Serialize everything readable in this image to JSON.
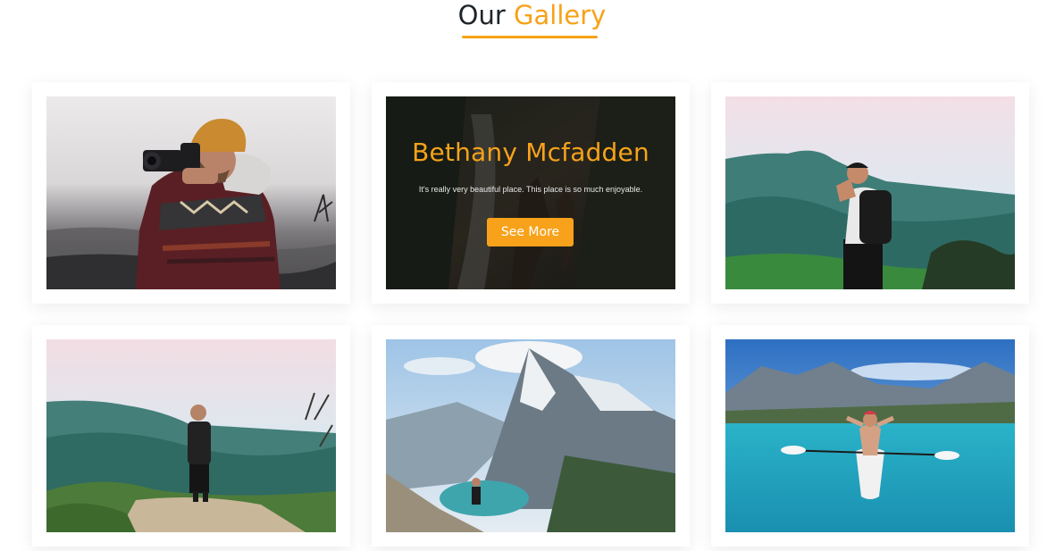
{
  "heading": {
    "part1": "Our",
    "part2": "Gallery"
  },
  "colors": {
    "accent": "#f7a21a",
    "heading_text": "#1f2429"
  },
  "gallery": {
    "items": [
      {
        "subject": "photographer-with-camera"
      },
      {
        "subject": "waterfall-hikers",
        "overlay": {
          "name": "Bethany Mcfadden",
          "description": "It's really very beautiful place. This place is so much enjoyable.",
          "button_label": "See More"
        }
      },
      {
        "subject": "hiker-with-binoculars"
      },
      {
        "subject": "hiker-on-cliff"
      },
      {
        "subject": "mountain-lake-hiker"
      },
      {
        "subject": "kayak-on-lake"
      }
    ]
  }
}
